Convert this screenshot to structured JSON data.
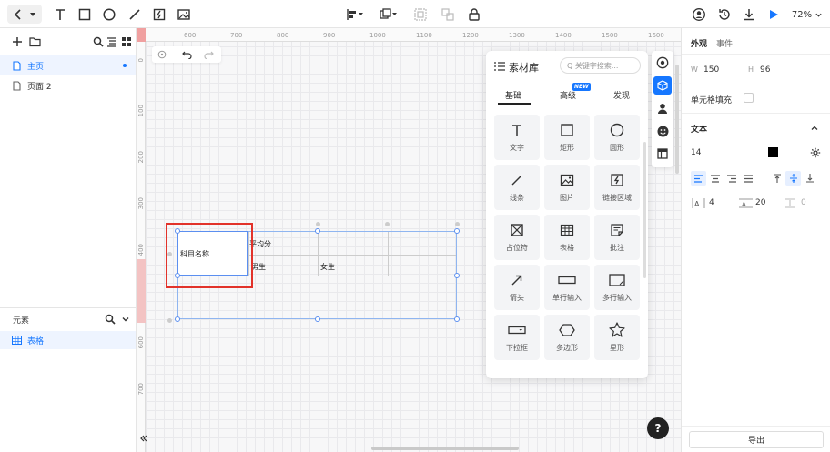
{
  "toolbar": {
    "zoom": "72%"
  },
  "left_panel": {
    "pages": [
      {
        "label": "主页",
        "active": true
      },
      {
        "label": "页面 2",
        "active": false
      }
    ],
    "elements_title": "元素",
    "elements": [
      {
        "label": "表格"
      }
    ]
  },
  "ruler": {
    "h_ticks": [
      "600",
      "700",
      "800",
      "900",
      "1000",
      "1100",
      "1200",
      "1300",
      "1400",
      "1500",
      "1600"
    ],
    "v_ticks": [
      "0",
      "100",
      "200",
      "300",
      "400",
      "500",
      "600",
      "700"
    ]
  },
  "canvas": {
    "table_cells": {
      "c1": "科目名称",
      "c2": "平均分",
      "c3": "男生",
      "c4": "女生"
    }
  },
  "library": {
    "title": "素材库",
    "search_placeholder": "Q 关键字搜索...",
    "tabs": [
      {
        "label": "基础",
        "active": true
      },
      {
        "label": "高级",
        "badge": "NEW"
      },
      {
        "label": "发现"
      }
    ],
    "items": [
      "文字",
      "矩形",
      "圆形",
      "线条",
      "图片",
      "链接区域",
      "占位符",
      "表格",
      "批注",
      "箭头",
      "单行输入",
      "多行输入",
      "下拉框",
      "多边形",
      "星形"
    ]
  },
  "right_panel": {
    "tabs": [
      "外观",
      "事件"
    ],
    "w_label": "W",
    "w_value": "150",
    "h_label": "H",
    "h_value": "96",
    "cell_fill_label": "单元格填充",
    "text_section": "文本",
    "font_size": "14",
    "text_color": "#000000",
    "letter_spacing": "4",
    "line_height": "20",
    "paragraph_spacing": "0",
    "export_label": "导出"
  },
  "colors": {
    "accent": "#1677ff",
    "selection": "#e2322a"
  },
  "help": "?"
}
